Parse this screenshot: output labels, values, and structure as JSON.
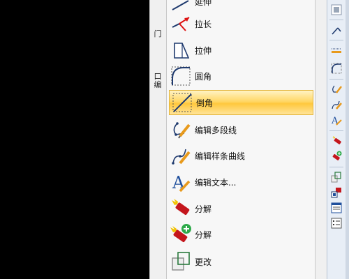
{
  "side_panel": {
    "label_top": "门",
    "label_bottom": "口编"
  },
  "menu": {
    "items": [
      {
        "label": "延伸",
        "icon": "extend-icon"
      },
      {
        "label": "拉长",
        "icon": "lengthen-icon"
      },
      {
        "label": "拉伸",
        "icon": "stretch-icon"
      },
      {
        "label": "圆角",
        "icon": "fillet-icon"
      },
      {
        "label": "倒角",
        "icon": "chamfer-icon",
        "highlighted": true
      },
      {
        "label": "编辑多段线",
        "icon": "edit-polyline-icon"
      },
      {
        "label": "编辑样条曲线",
        "icon": "edit-spline-icon"
      },
      {
        "label": "编辑文本...",
        "icon": "edit-text-icon"
      },
      {
        "label": "分解",
        "icon": "explode-icon"
      },
      {
        "label": "分解",
        "icon": "explode-add-icon"
      },
      {
        "label": "更改",
        "icon": "change-icon"
      }
    ]
  },
  "toolbar": {
    "buttons": [
      "zoom-icon",
      "extend-icon",
      "stretch-icon",
      "fillet-icon",
      "edit-polyline-icon",
      "edit-spline-icon",
      "edit-text-icon",
      "explode-icon",
      "explode-add-icon",
      "copy-icon",
      "match-props-icon",
      "layer-icon",
      "list-icon"
    ]
  },
  "colors": {
    "highlight": "#ffd767",
    "highlight_border": "#e3b53c",
    "menu_bg": "#f7f7f7",
    "toolbar_bg": "#e8eef6"
  }
}
